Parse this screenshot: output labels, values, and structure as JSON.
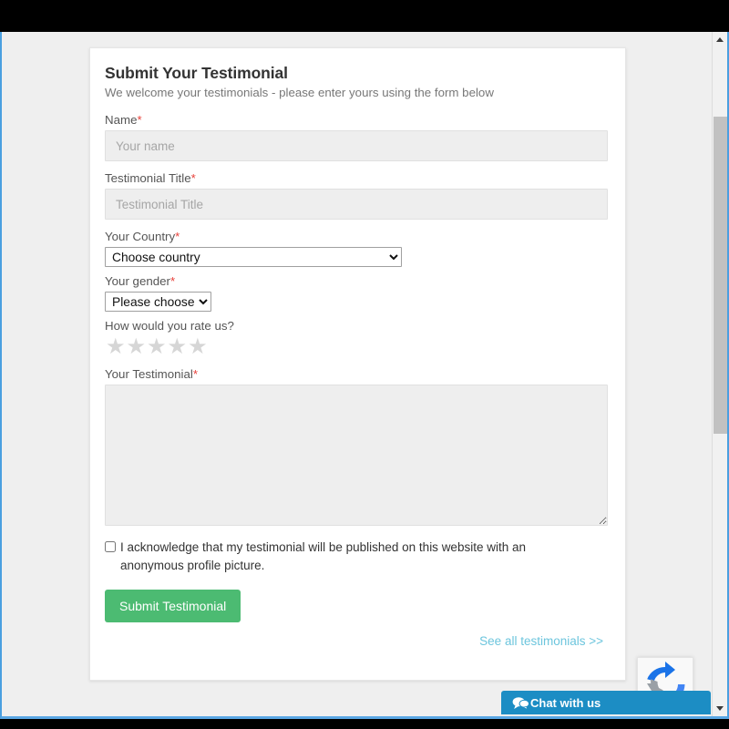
{
  "form": {
    "title": "Submit Your Testimonial",
    "subtitle": "We welcome your testimonials - please enter yours using the form below",
    "fields": {
      "name": {
        "label": "Name",
        "required_marker": "*",
        "placeholder": "Your name",
        "value": ""
      },
      "testimonial_title": {
        "label": "Testimonial Title",
        "required_marker": "*",
        "placeholder": "Testimonial Title",
        "value": ""
      },
      "country": {
        "label": "Your Country",
        "required_marker": "*",
        "selected": "Choose country",
        "options": [
          "Choose country"
        ]
      },
      "gender": {
        "label": "Your gender",
        "required_marker": "*",
        "selected": "Please choose",
        "options": [
          "Please choose"
        ]
      },
      "rating": {
        "label": "How would you rate us?",
        "value": 0,
        "max": 5,
        "star_glyph": "★",
        "empty_color": "#d6d6d6"
      },
      "testimonial": {
        "label": "Your Testimonial",
        "required_marker": "*",
        "placeholder": "",
        "value": ""
      }
    },
    "acknowledge": {
      "checked": false,
      "text": "I acknowledge that my testimonial will be published on this website with an anonymous profile picture."
    },
    "submit_label": "Submit Testimonial",
    "see_all_label": "See all testimonials >>"
  },
  "chat": {
    "label": "Chat with us",
    "icon": "chat-bubble-icon",
    "color": "#1c8dc4"
  },
  "recaptcha": {
    "icon": "recaptcha-logo-icon"
  },
  "scrollbar": {
    "up_icon": "chevron-up-icon",
    "down_icon": "chevron-down-icon"
  },
  "colors": {
    "accent_green": "#4cbb72",
    "link_blue": "#6cc5dd",
    "required_red": "#e8403a",
    "page_background": "#efefef"
  }
}
